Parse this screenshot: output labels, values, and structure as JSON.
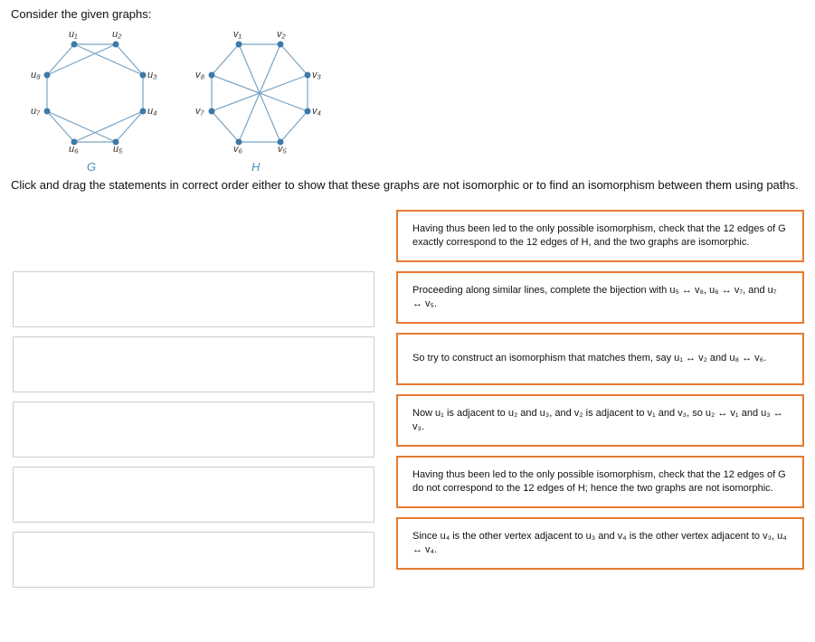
{
  "header": "Consider the given graphs:",
  "instruction": "Click and drag the statements in correct order either to show that these graphs are not isomorphic or to find an isomorphism between them using paths.",
  "graphG": {
    "label": "G",
    "vertices": [
      "u₁",
      "u₂",
      "u₃",
      "u₄",
      "u₅",
      "u₆",
      "u₇",
      "u₈"
    ]
  },
  "graphH": {
    "label": "H",
    "vertices": [
      "v₁",
      "v₂",
      "v₃",
      "v₄",
      "v₅",
      "v₆",
      "v₇",
      "v₈"
    ]
  },
  "statements": [
    "Having thus been led to the only possible isomorphism, check that the 12 edges of G exactly correspond to the 12 edges of H, and the two graphs are isomorphic.",
    "Proceeding along similar lines, complete the bijection with u₅ ↔ v₈, u₆ ↔ v₇, and u₇ ↔ v₅.",
    "So try to construct an isomorphism that matches them, say u₁ ↔ v₂ and u₈ ↔ v₆.",
    "Now u₁ is adjacent to u₂ and u₃, and v₂ is adjacent to v₁ and v₃, so u₂ ↔ v₁ and u₃ ↔ v₃.",
    "Having thus been led to the only possible isomorphism, check that the 12 edges of G do not correspond to the 12 edges of H; hence the two graphs are not isomorphic.",
    "Since u₄ is the other vertex adjacent to u₃ and v₄ is the other vertex adjacent to v₃, u₄ ↔ v₄."
  ],
  "slots": 5
}
